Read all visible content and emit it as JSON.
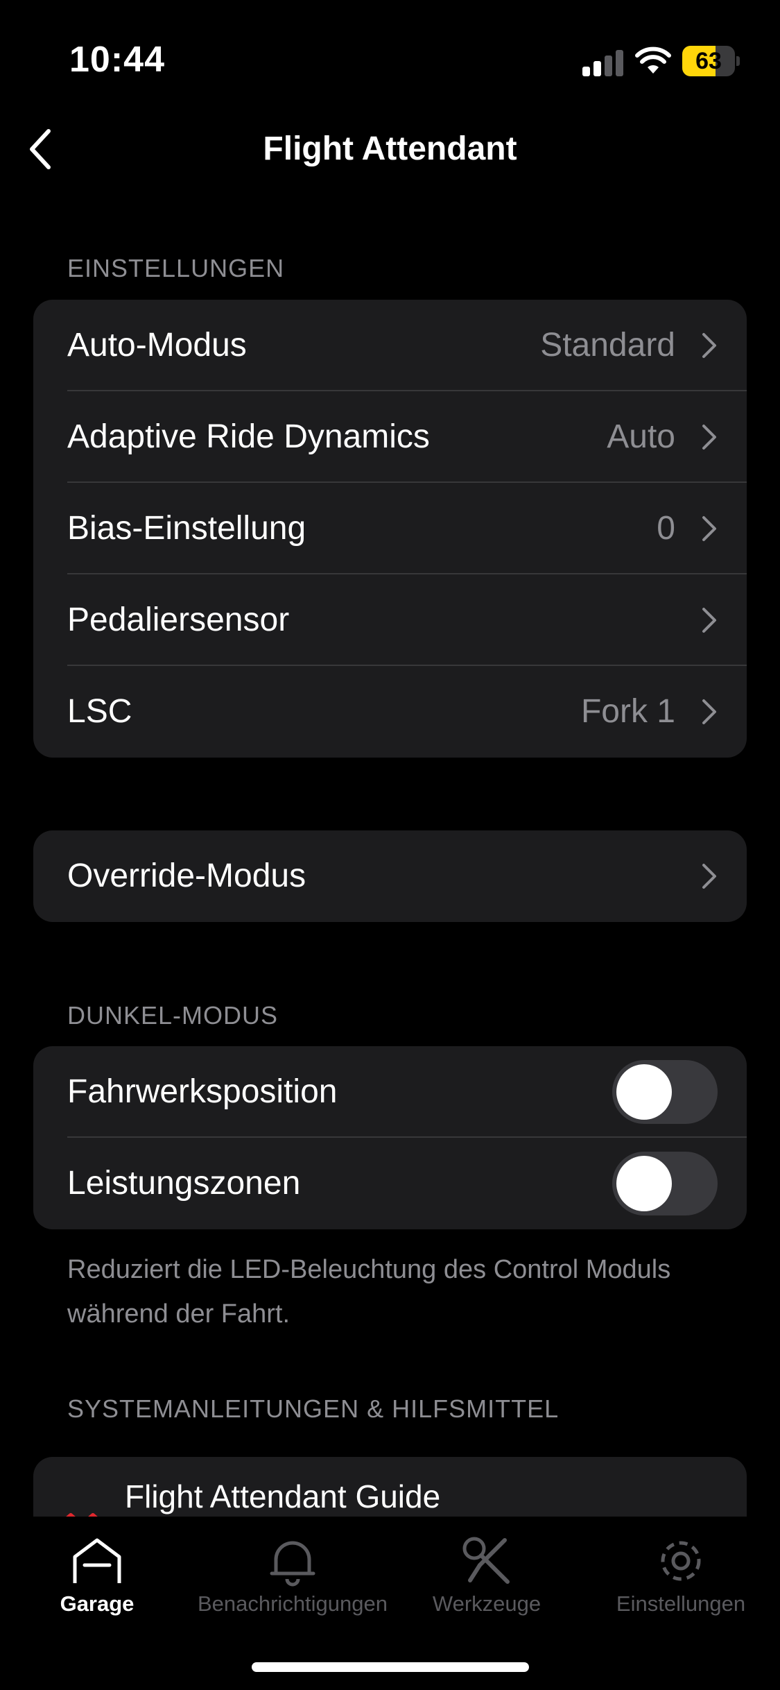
{
  "status_bar": {
    "time": "10:44",
    "battery_percent": "63",
    "battery_level": 0.63
  },
  "nav": {
    "title": "Flight Attendant"
  },
  "einstellungen": {
    "header": "EINSTELLUNGEN",
    "rows": [
      {
        "label": "Auto-Modus",
        "value": "Standard"
      },
      {
        "label": "Adaptive Ride Dynamics",
        "value": "Auto"
      },
      {
        "label": "Bias-Einstellung",
        "value": "0"
      },
      {
        "label": "Pedaliersensor",
        "value": ""
      },
      {
        "label": "LSC",
        "value": "Fork 1"
      }
    ]
  },
  "override": {
    "label": "Override-Modus"
  },
  "dunkel_modus": {
    "header": "DUNKEL-MODUS",
    "rows": [
      {
        "label": "Fahrwerksposition",
        "on": false
      },
      {
        "label": "Leistungszonen",
        "on": false
      }
    ],
    "footnote": "Reduziert die LED-Beleuchtung des Control Moduls während der Fahrt."
  },
  "system": {
    "header": "SYSTEMANLEITUNGEN & HILFSMITTEL",
    "guide_title": "Flight Attendant Guide"
  },
  "tabs": [
    {
      "label": "Garage",
      "icon": "garage-icon",
      "active": true
    },
    {
      "label": "Benachrichtigungen",
      "icon": "bell-icon",
      "active": false
    },
    {
      "label": "Werkzeuge",
      "icon": "tools-icon",
      "active": false
    },
    {
      "label": "Einstellungen",
      "icon": "gear-icon",
      "active": false
    }
  ],
  "colors": {
    "background": "#000000",
    "card": "#1c1c1e",
    "secondary_text": "#8e8e93",
    "battery_fill": "#ffd60a",
    "toggle_off": "#39393d"
  }
}
